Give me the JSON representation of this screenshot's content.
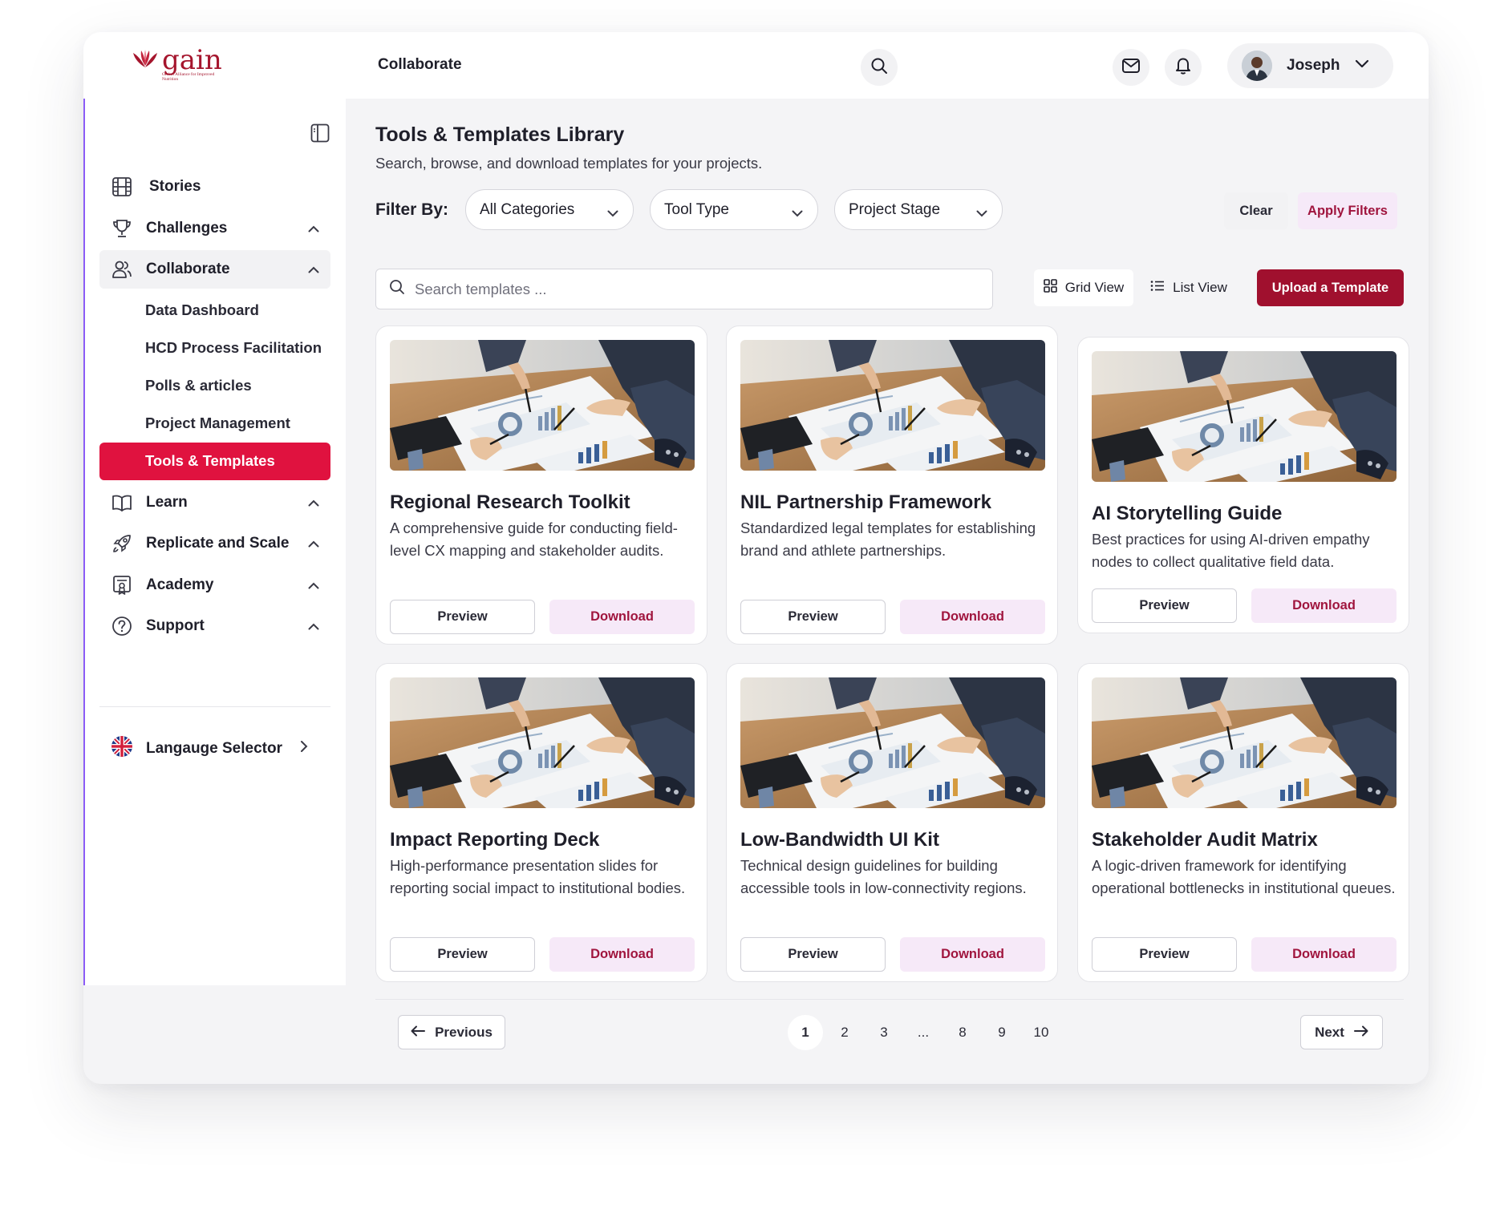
{
  "brand": {
    "name": "gain",
    "tagline": "Global Alliance for Improved Nutrition",
    "color": "#a5152d"
  },
  "header": {
    "section_title": "Collaborate",
    "user_name": "Joseph"
  },
  "sidebar": {
    "items": [
      {
        "label": "Stories"
      },
      {
        "label": "Challenges"
      },
      {
        "label": "Collaborate"
      },
      {
        "label": "Learn"
      },
      {
        "label": "Replicate and Scale"
      },
      {
        "label": "Academy"
      },
      {
        "label": "Support"
      }
    ],
    "sub_items": [
      {
        "label": "Data Dashboard"
      },
      {
        "label": "HCD Process Facilitation"
      },
      {
        "label": "Polls & articles"
      },
      {
        "label": "Project Management"
      },
      {
        "label": "Tools & Templates"
      }
    ],
    "language_label": "Langauge Selector",
    "active_color": "#e0123f"
  },
  "main": {
    "title": "Tools & Templates Library",
    "subtitle": "Search, browse, and download templates for your projects.",
    "filter_label": "Filter By:",
    "filters": [
      {
        "value": "All Categories"
      },
      {
        "value": "Tool Type"
      },
      {
        "value": "Project Stage"
      }
    ],
    "clear_label": "Clear",
    "apply_label": "Apply Filters",
    "search_placeholder": "Search templates ...",
    "grid_view_label": "Grid View",
    "list_view_label": "List View",
    "upload_label": "Upload a Template",
    "accent_color": "#a0102e"
  },
  "cards": [
    {
      "title": "Regional Research Toolkit",
      "description": "A comprehensive guide for conducting field-level CX mapping and stakeholder audits.",
      "preview_label": "Preview",
      "download_label": "Download"
    },
    {
      "title": "NIL Partnership Framework",
      "description": "Standardized legal templates for establishing brand and athlete partnerships.",
      "preview_label": "Preview",
      "download_label": "Download"
    },
    {
      "title": "AI Storytelling Guide",
      "description": "Best practices for using AI-driven empathy nodes to collect qualitative field data.",
      "preview_label": "Preview",
      "download_label": "Download"
    },
    {
      "title": "Impact Reporting Deck",
      "description": "High-performance presentation slides for reporting social impact to institutional bodies.",
      "preview_label": "Preview",
      "download_label": "Download"
    },
    {
      "title": "Low-Bandwidth UI Kit",
      "description": "Technical design guidelines for building accessible tools in low-connectivity regions.",
      "preview_label": "Preview",
      "download_label": "Download"
    },
    {
      "title": "Stakeholder Audit Matrix",
      "description": "A logic-driven framework for identifying operational bottlenecks in institutional queues.",
      "preview_label": "Preview",
      "download_label": "Download"
    }
  ],
  "pagination": {
    "previous_label": "Previous",
    "next_label": "Next",
    "pages": [
      "1",
      "2",
      "3",
      "...",
      "8",
      "9",
      "10"
    ],
    "current": "1"
  }
}
